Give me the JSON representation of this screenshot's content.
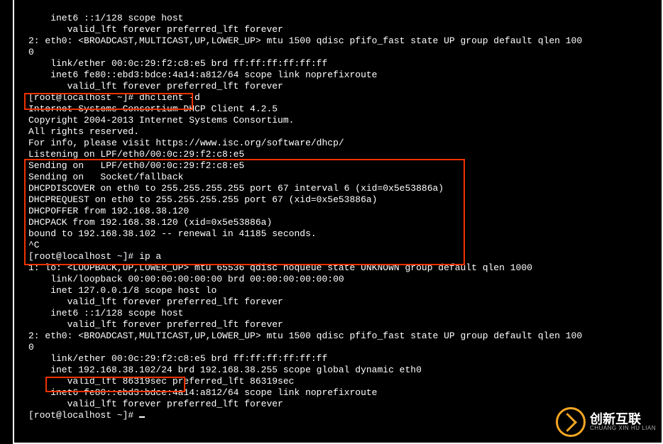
{
  "terminal": {
    "lines": [
      "    inet6 ::1/128 scope host ",
      "       valid_lft forever preferred_lft forever",
      "2: eth0: <BROADCAST,MULTICAST,UP,LOWER_UP> mtu 1500 qdisc pfifo_fast state UP group default qlen 100",
      "0",
      "    link/ether 00:0c:29:f2:c8:e5 brd ff:ff:ff:ff:ff:ff",
      "    inet6 fe80::ebd3:bdce:4a14:a812/64 scope link noprefixroute ",
      "       valid_lft forever preferred_lft forever",
      "[root@localhost ~]# dhclient -d",
      "Internet Systems Consortium DHCP Client 4.2.5",
      "Copyright 2004-2013 Internet Systems Consortium.",
      "All rights reserved.",
      "For info, please visit https://www.isc.org/software/dhcp/",
      "",
      "Listening on LPF/eth0/00:0c:29:f2:c8:e5",
      "Sending on   LPF/eth0/00:0c:29:f2:c8:e5",
      "Sending on   Socket/fallback",
      "DHCPDISCOVER on eth0 to 255.255.255.255 port 67 interval 6 (xid=0x5e53886a)",
      "DHCPREQUEST on eth0 to 255.255.255.255 port 67 (xid=0x5e53886a)",
      "DHCPOFFER from 192.168.38.120",
      "DHCPACK from 192.168.38.120 (xid=0x5e53886a)",
      "bound to 192.168.38.102 -- renewal in 41185 seconds.",
      "^C",
      "[root@localhost ~]# ip a",
      "1: lo: <LOOPBACK,UP,LOWER_UP> mtu 65536 qdisc noqueue state UNKNOWN group default qlen 1000",
      "    link/loopback 00:00:00:00:00:00 brd 00:00:00:00:00:00",
      "    inet 127.0.0.1/8 scope host lo",
      "       valid_lft forever preferred_lft forever",
      "    inet6 ::1/128 scope host ",
      "       valid_lft forever preferred_lft forever",
      "2: eth0: <BROADCAST,MULTICAST,UP,LOWER_UP> mtu 1500 qdisc pfifo_fast state UP group default qlen 100",
      "0",
      "    link/ether 00:0c:29:f2:c8:e5 brd ff:ff:ff:ff:ff:ff",
      "    inet 192.168.38.102/24 brd 192.168.38.255 scope global dynamic eth0",
      "       valid_lft 86319sec preferred_lft 86319sec",
      "    inet6 fe80::ebd3:bdce:4a14:a812/64 scope link noprefixroute ",
      "       valid_lft forever preferred_lft forever",
      "[root@localhost ~]# "
    ]
  },
  "watermark": {
    "cn": "创新互联",
    "en": "CHUANG XIN HU LIAN"
  }
}
